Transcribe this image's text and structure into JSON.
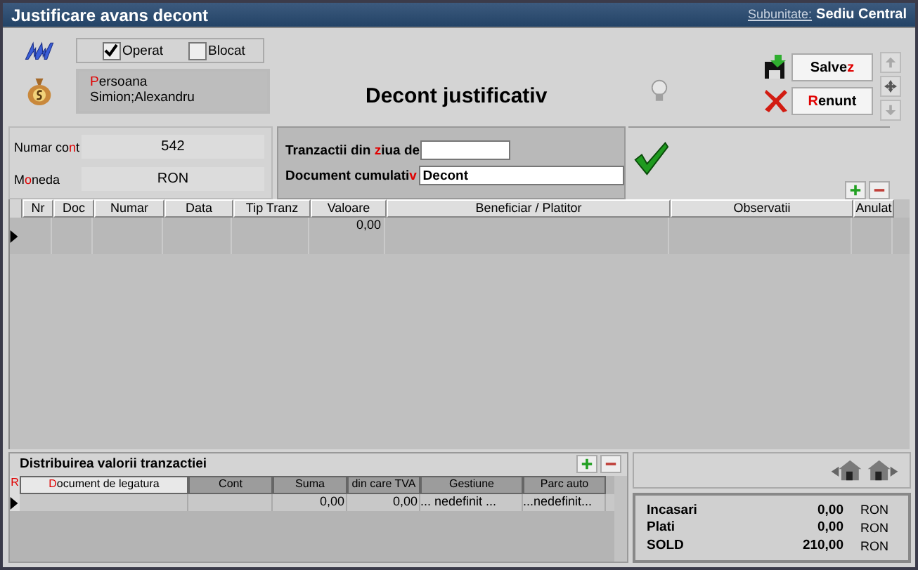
{
  "window": {
    "title": "Justificare avans decont",
    "subunit_label": "Subunitate:",
    "subunit_value": "Sediu Central"
  },
  "flags": [
    {
      "label": "Operat",
      "checked": true
    },
    {
      "label": "Blocat",
      "checked": false
    }
  ],
  "person": {
    "label": {
      "key": "P",
      "after": "ersoana"
    },
    "value": "Simion;Alexandru"
  },
  "heading": "Decont justificativ",
  "buttons": [
    {
      "kind": "save",
      "label": {
        "before": "Salve",
        "key": "z"
      }
    },
    {
      "kind": "cancel",
      "label": {
        "key": "R",
        "after": "enunt"
      }
    }
  ],
  "account": [
    {
      "label": {
        "before": "Numar co",
        "key": "n",
        "after": "t"
      },
      "value": "542"
    },
    {
      "label": {
        "before": "M",
        "key": "o",
        "after": "neda"
      },
      "value": "RON"
    }
  ],
  "filters": [
    {
      "label": {
        "before": "Tranzactii din ",
        "key": "z",
        "after": "iua de"
      }
    },
    {
      "label": {
        "before": "Document cumulati",
        "key": "v"
      },
      "value": "Decont"
    }
  ],
  "table": {
    "columns": [
      "Nr",
      "Doc",
      "Numar",
      "Data",
      "Tip Tranz",
      "Valoare",
      "Beneficiar  / Platitor",
      "Observatii",
      "Anulat"
    ],
    "rows": [
      [
        "",
        "",
        "",
        "",
        "",
        "0,00",
        "",
        "",
        ""
      ]
    ]
  },
  "distribution": {
    "title": "Distribuirea valorii tranzactiei",
    "marker": "R",
    "columns": [
      {
        "key": "D",
        "after": "ocument de legatura"
      },
      {
        "before": "Cont"
      },
      {
        "before": "Suma"
      },
      {
        "before": "din care TVA"
      },
      {
        "before": "Gestiune"
      },
      {
        "before": "Parc auto"
      }
    ],
    "rows": [
      [
        "",
        "",
        "0,00",
        "0,00",
        "... nedefinit ...",
        "...nedefinit..."
      ]
    ]
  },
  "totals": [
    {
      "label": "Incasari",
      "amount": "0,00",
      "currency": "RON"
    },
    {
      "label": "Plati",
      "amount": "0,00",
      "currency": "RON"
    },
    {
      "label": "SOLD",
      "amount": "210,00",
      "currency": "RON"
    }
  ]
}
